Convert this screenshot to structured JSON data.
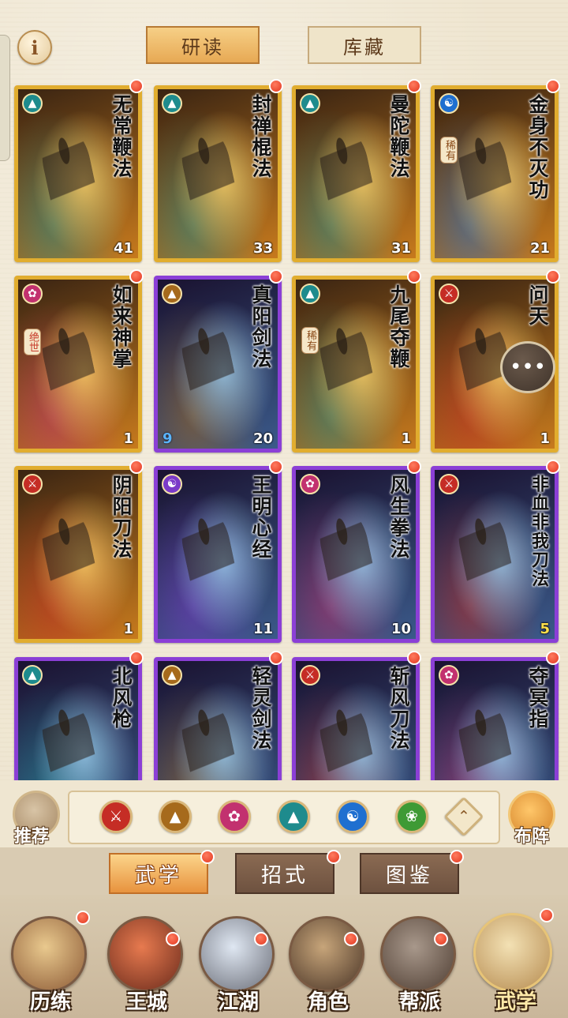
{
  "top_tabs": {
    "study": "研读",
    "collection": "库藏"
  },
  "info_label": "i",
  "cards": [
    {
      "name": "无常鞭法",
      "count": "41",
      "frame": "gold",
      "school": "teal",
      "school_icon": "fan-icon",
      "rarity": ""
    },
    {
      "name": "封禅棍法",
      "count": "33",
      "frame": "gold",
      "school": "teal",
      "school_icon": "fan-icon",
      "rarity": ""
    },
    {
      "name": "曼陀鞭法",
      "count": "31",
      "frame": "gold",
      "school": "teal",
      "school_icon": "fan-icon",
      "rarity": ""
    },
    {
      "name": "金身不灭功",
      "count": "21",
      "frame": "gold",
      "school": "blue",
      "school_icon": "yin-yang-icon",
      "rarity": "稀有"
    },
    {
      "name": "如来神掌",
      "count": "1",
      "frame": "gold",
      "school": "magenta",
      "school_icon": "lotus-icon",
      "rarity": "绝世"
    },
    {
      "name": "真阳剑法",
      "count": "20",
      "frame": "purple",
      "school": "brown",
      "school_icon": "sword-icon",
      "rarity": "",
      "level": "9"
    },
    {
      "name": "九尾夺鞭",
      "count": "1",
      "frame": "gold",
      "school": "teal",
      "school_icon": "fan-icon",
      "rarity": "稀有"
    },
    {
      "name": "问天",
      "count": "1",
      "frame": "gold",
      "school": "red",
      "school_icon": "blade-icon",
      "rarity": ""
    },
    {
      "name": "阴阳刀法",
      "count": "1",
      "frame": "gold",
      "school": "red",
      "school_icon": "blade-icon",
      "rarity": ""
    },
    {
      "name": "王明心经",
      "count": "11",
      "frame": "purple",
      "school": "purple",
      "school_icon": "yin-yang-icon",
      "rarity": ""
    },
    {
      "name": "风生拳法",
      "count": "10",
      "frame": "purple",
      "school": "magenta",
      "school_icon": "lotus-icon",
      "rarity": ""
    },
    {
      "name": "非血非我刀法",
      "count": "5",
      "frame": "purple",
      "school": "red",
      "school_icon": "blade-icon",
      "rarity": ""
    },
    {
      "name": "北风枪",
      "count": "",
      "frame": "purple",
      "school": "teal",
      "school_icon": "fan-icon",
      "rarity": ""
    },
    {
      "name": "轻灵剑法",
      "count": "",
      "frame": "purple",
      "school": "brown",
      "school_icon": "sword-icon",
      "rarity": ""
    },
    {
      "name": "斩风刀法",
      "count": "",
      "frame": "purple",
      "school": "red",
      "school_icon": "blade-icon",
      "rarity": ""
    },
    {
      "name": "夺冥指",
      "count": "",
      "frame": "purple",
      "school": "magenta",
      "school_icon": "lotus-icon",
      "rarity": ""
    }
  ],
  "filter_bar": {
    "left_button": "推荐",
    "right_button": "布阵",
    "icons": [
      "blade-icon",
      "sword-icon",
      "lotus-icon",
      "fan-icon",
      "yin-yang-icon",
      "leaf-icon",
      "up-arrow-icon"
    ]
  },
  "sub_tabs": {
    "martial": "武学",
    "moves": "招式",
    "atlas": "图鉴"
  },
  "bottom_nav": [
    "历练",
    "王城",
    "江湖",
    "角色",
    "帮派",
    "武学"
  ],
  "colors": {
    "teal": "#1e8b8d",
    "blue": "#1f6fd0",
    "magenta": "#c2316f",
    "brown": "#a66a1c",
    "red": "#c52d25",
    "purple": "#7b3ac8",
    "green": "#3e9a35"
  }
}
